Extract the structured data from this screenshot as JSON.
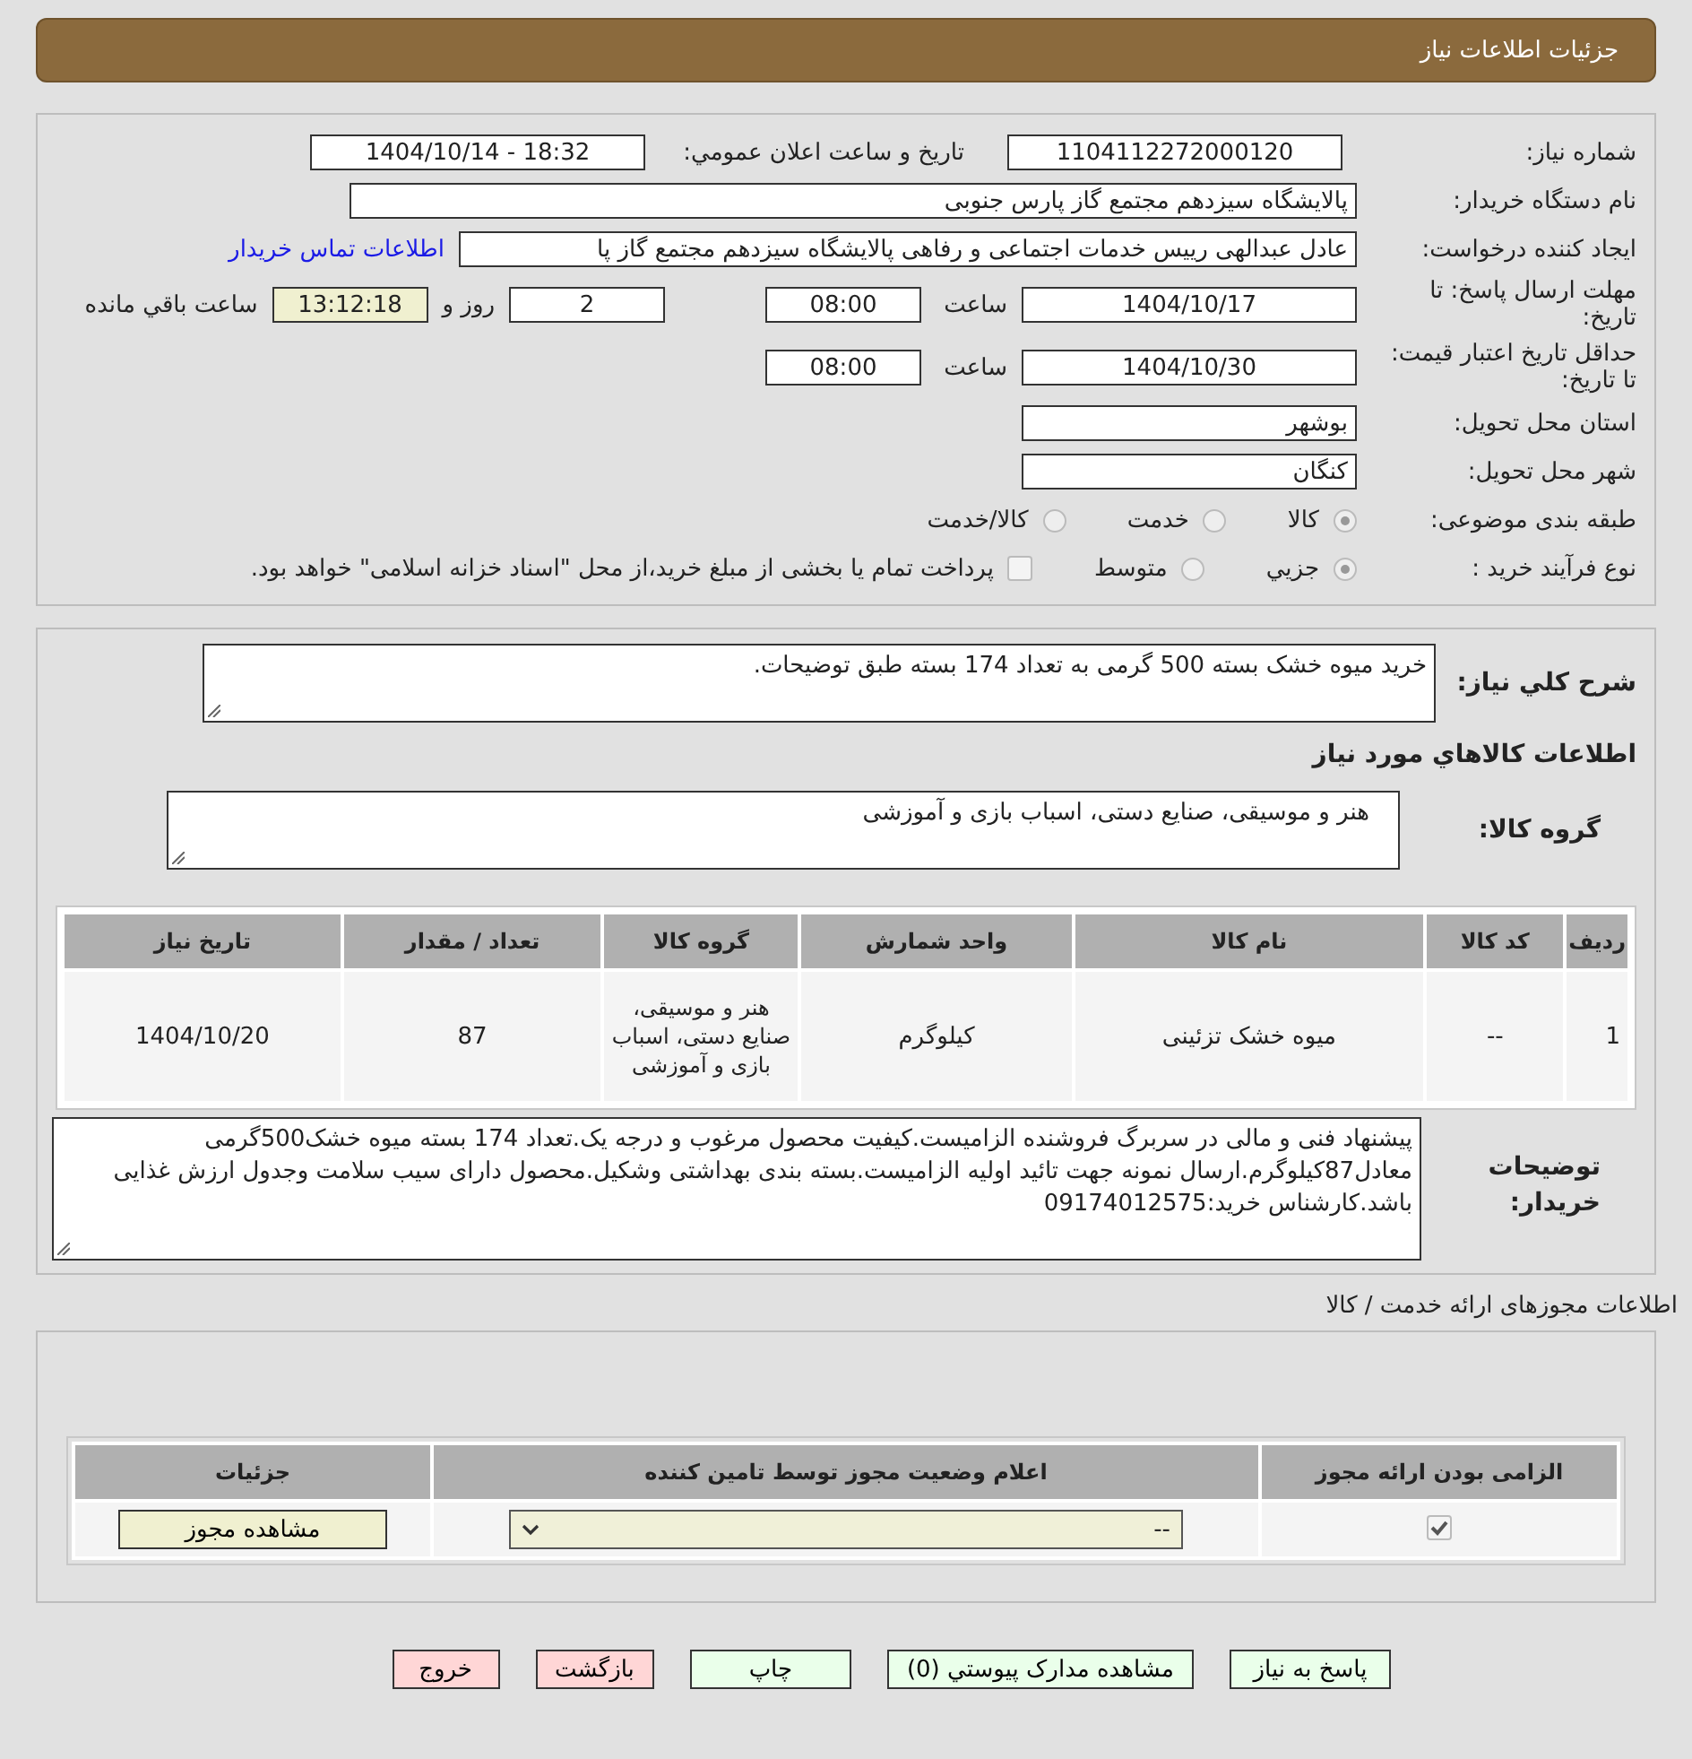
{
  "header": {
    "title": "جزئیات اطلاعات نیاز"
  },
  "need_number": {
    "label": "شماره نیاز:",
    "value": "1104112272000120"
  },
  "announce": {
    "label": "تاریخ و ساعت اعلان عمومي:",
    "value": "1404/10/14 - 18:32"
  },
  "buyer": {
    "label": "نام دستگاه خریدار:",
    "value": "پالایشگاه سیزدهم مجتمع گاز پارس جنوبی"
  },
  "requester": {
    "label": "ایجاد کننده درخواست:",
    "value": "عادل عبدالهی رییس خدمات اجتماعی و رفاهی پالایشگاه سیزدهم مجتمع گاز پا",
    "link": "اطلاعات تماس خريدار"
  },
  "deadline": {
    "label": "مهلت ارسال پاسخ: تا تاریخ:",
    "date": "1404/10/17",
    "time_label": "ساعت",
    "time": "08:00",
    "days": "2",
    "days_label": "روز و",
    "remaining": "13:12:18",
    "remaining_label": "ساعت باقي مانده"
  },
  "validity": {
    "label": "حداقل تاریخ اعتبار قیمت: تا تاریخ:",
    "date": "1404/10/30",
    "time_label": "ساعت",
    "time": "08:00"
  },
  "province": {
    "label": "استان محل تحویل:",
    "value": "بوشهر"
  },
  "city": {
    "label": "شهر محل تحویل:",
    "value": "کنگان"
  },
  "category": {
    "label": "طبقه بندی موضوعی:",
    "options": [
      {
        "label": "کالا",
        "selected": true
      },
      {
        "label": "خدمت",
        "selected": false
      },
      {
        "label": "کالا/خدمت",
        "selected": false
      }
    ]
  },
  "process": {
    "label": "نوع فرآیند خرید :",
    "options": [
      {
        "label": "جزيي",
        "selected": true
      },
      {
        "label": "متوسط",
        "selected": false
      }
    ],
    "treasury": {
      "checked": false,
      "label": "پرداخت تمام یا بخشی از مبلغ خرید،از محل \"اسناد خزانه اسلامی\" خواهد بود."
    }
  },
  "summary": {
    "label": "شرح کلي نیاز:",
    "value": "خرید میوه خشک بسته 500 گرمی به تعداد 174 بسته طبق توضیحات."
  },
  "goods_title": "اطلاعات کالاهاي مورد نیاز",
  "goods_group": {
    "label": "گروه کالا:",
    "value": "هنر و موسیقی، صنایع دستی، اسباب بازی و آموزشی"
  },
  "goods_table": {
    "columns": [
      "ردیف",
      "کد کالا",
      "نام کالا",
      "واحد شمارش",
      "گروه کالا",
      "تعداد / مقدار",
      "تاریخ نیاز"
    ],
    "rows": [
      [
        "1",
        "--",
        "میوه خشک تزئینی",
        "کیلوگرم",
        "هنر و موسیقی، صنایع دستی، اسباب بازی و آموزشی",
        "87",
        "1404/10/20"
      ]
    ]
  },
  "buyer_notes": {
    "label": "توضیحات خریدار:",
    "value": "پیشنهاد فنی و مالی در سربرگ فروشنده الزامیست.کیفیت محصول مرغوب و درجه یک.تعداد 174 بسته میوه خشک500گرمی معادل87کیلوگرم.ارسال نمونه جهت تائید اولیه الزامیست.بسته بندی بهداشتی وشکیل.محصول دارای سیب سلامت وجدول ارزش غذایی باشد.کارشناس خرید:09174012575"
  },
  "license_title": "اطلاعات مجوزهای ارائه خدمت / کالا",
  "license_table": {
    "columns": [
      "الزامی بودن ارائه مجوز",
      "اعلام وضعیت مجوز توسط تامین کننده",
      "جزئیات"
    ],
    "rows": [
      {
        "required": true,
        "status": "--",
        "action": "مشاهده مجوز"
      }
    ]
  },
  "buttons": [
    {
      "label": "پاسخ به نیاز",
      "kind": "action"
    },
    {
      "label": "مشاهده مدارک پیوستي (0)",
      "kind": "action"
    },
    {
      "label": "چاپ",
      "kind": "action"
    },
    {
      "label": "بازگشت",
      "kind": "exit"
    },
    {
      "label": "خروج",
      "kind": "exit"
    }
  ]
}
